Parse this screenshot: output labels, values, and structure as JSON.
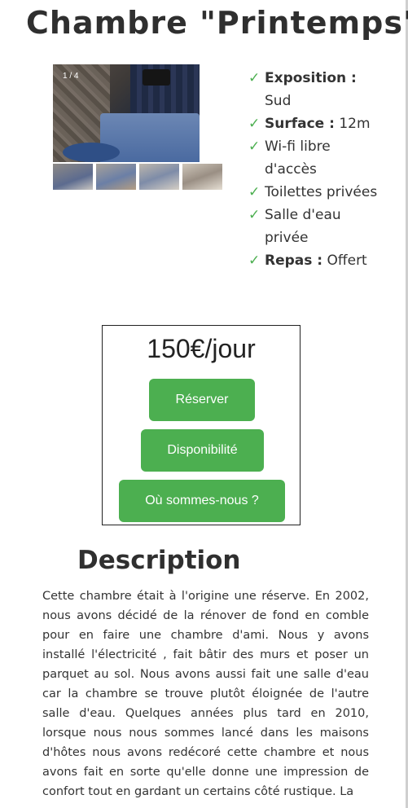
{
  "page": {
    "title": "Chambre \"Printemps\""
  },
  "gallery": {
    "counter": "1 / 4",
    "thumbnail_count": 4
  },
  "features": [
    {
      "label": "Exposition :",
      "value": "Sud"
    },
    {
      "label": "Surface :",
      "value": "12m"
    },
    {
      "label": "",
      "value": "Wi-fi libre d'accès"
    },
    {
      "label": "",
      "value": "Toilettes privées"
    },
    {
      "label": "",
      "value": "Salle d'eau privée"
    },
    {
      "label": "Repas :",
      "value": "Offert"
    }
  ],
  "check_symbol": "✓",
  "pricing": {
    "price": "150€/jour",
    "reserve_label": "Réserver",
    "availability_label": "Disponibilité",
    "location_label": "Où sommes-nous ?"
  },
  "description": {
    "heading": "Description",
    "text": "Cette chambre était à l'origine une réserve. En 2002, nous avons décidé de la rénover de fond en comble pour en faire une chambre d'ami. Nous y avons installé l'électricité , fait bâtir des murs et poser un parquet au sol. Nous avons aussi fait une salle d'eau car la chambre se trouve plutôt éloignée de l'autre salle d'eau. Quelques années plus tard en 2010, lorsque nous nous sommes lancé dans les maisons d'hôtes nous avons redécoré cette chambre et nous avons fait en sorte qu'elle donne une impression de confort tout en gardant un certains côté rustique. La"
  },
  "colors": {
    "accent_green": "#4caf50",
    "text": "#333333"
  }
}
